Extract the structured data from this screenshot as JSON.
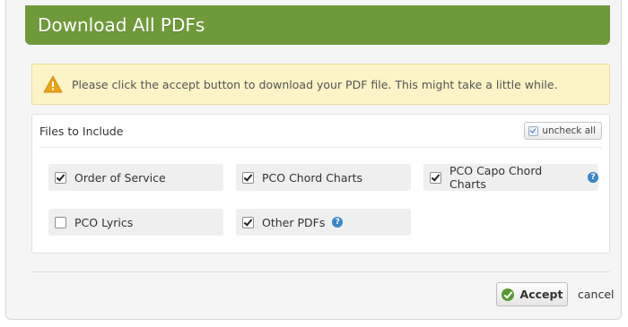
{
  "dialog": {
    "title": "Download All PDFs"
  },
  "alert": {
    "message": "Please click the accept button to download your PDF file. This might take a little while.",
    "icon": "warning-icon"
  },
  "files": {
    "heading": "Files to Include",
    "uncheck_all_label": "uncheck all",
    "options": [
      {
        "label": "Order of Service",
        "checked": true,
        "help": false
      },
      {
        "label": "PCO Chord Charts",
        "checked": true,
        "help": false
      },
      {
        "label": "PCO Capo Chord Charts",
        "checked": true,
        "help": true
      },
      {
        "label": "PCO Lyrics",
        "checked": false,
        "help": false
      },
      {
        "label": "Other PDFs",
        "checked": true,
        "help": true
      }
    ]
  },
  "footer": {
    "accept_label": "Accept",
    "cancel_label": "cancel"
  },
  "colors": {
    "header": "#6f9a3a",
    "alert_bg": "#fcf3c6",
    "help_icon": "#3a86c8",
    "accept_icon": "#5a9a32"
  }
}
